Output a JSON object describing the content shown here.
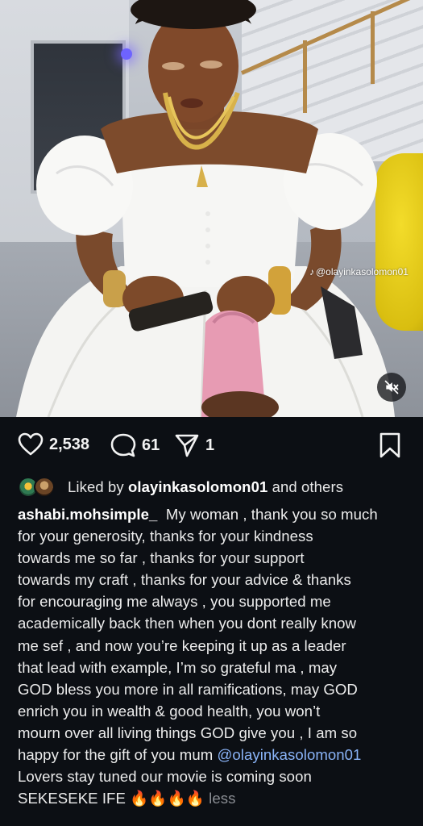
{
  "media": {
    "watermark": "@olayinkasolomon01",
    "watermark_icon": "tiktok-icon",
    "mute_icon": "speaker-muted-icon"
  },
  "actions": {
    "likes": "2,538",
    "comments": "61",
    "shares": "1",
    "icons": [
      "heart-icon",
      "comment-icon",
      "share-icon",
      "bookmark-icon"
    ]
  },
  "liked_by": {
    "prefix": "Liked by",
    "user": "olayinkasolomon01",
    "suffix": "and others"
  },
  "caption": {
    "username": "ashabi.mohsimple_",
    "lines": [
      "My woman , thank you so much",
      "for your generosity, thanks for your kindness",
      "towards me so far , thanks for your support",
      "towards my craft , thanks for your advice & thanks",
      "for encouraging me always , you supported me",
      "academically back then when you dont really know",
      "me sef , and now you’re keeping it up as a leader",
      "that lead with example, I’m so grateful ma , may",
      "GOD bless you more in all ramifications, may GOD",
      "enrich you in wealth & good health, you won’t",
      "mourn over all living things GOD give you , I am so"
    ],
    "line12_text": "happy for the gift of you mum",
    "mention": "@olayinkasolomon01",
    "line13": "Lovers stay tuned our movie is coming soon",
    "line14_text": "SEKESEKE IFE",
    "emoji": "🔥🔥🔥🔥",
    "less_label": "less"
  }
}
